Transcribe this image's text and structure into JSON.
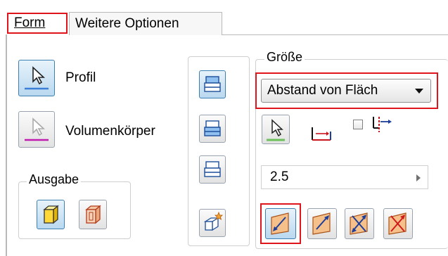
{
  "tabs": [
    {
      "label": "Form",
      "active": true
    },
    {
      "label": "Weitere Optionen",
      "active": false
    }
  ],
  "left": {
    "profile_label": "Profil",
    "solid_label": "Volumenkörper",
    "output_group_title": "Ausgabe"
  },
  "size": {
    "group_title": "Größe",
    "extent_dropdown_value": "Abstand von Fläch",
    "distance_value": "2.5",
    "checkbox_checked": false
  },
  "colors": {
    "highlight_red": "#e0141b",
    "active_blue": "#3c7fb1",
    "profile_line": "#3c7fd8",
    "solid_line": "#c21bb0",
    "select_green": "#6cc05a"
  }
}
